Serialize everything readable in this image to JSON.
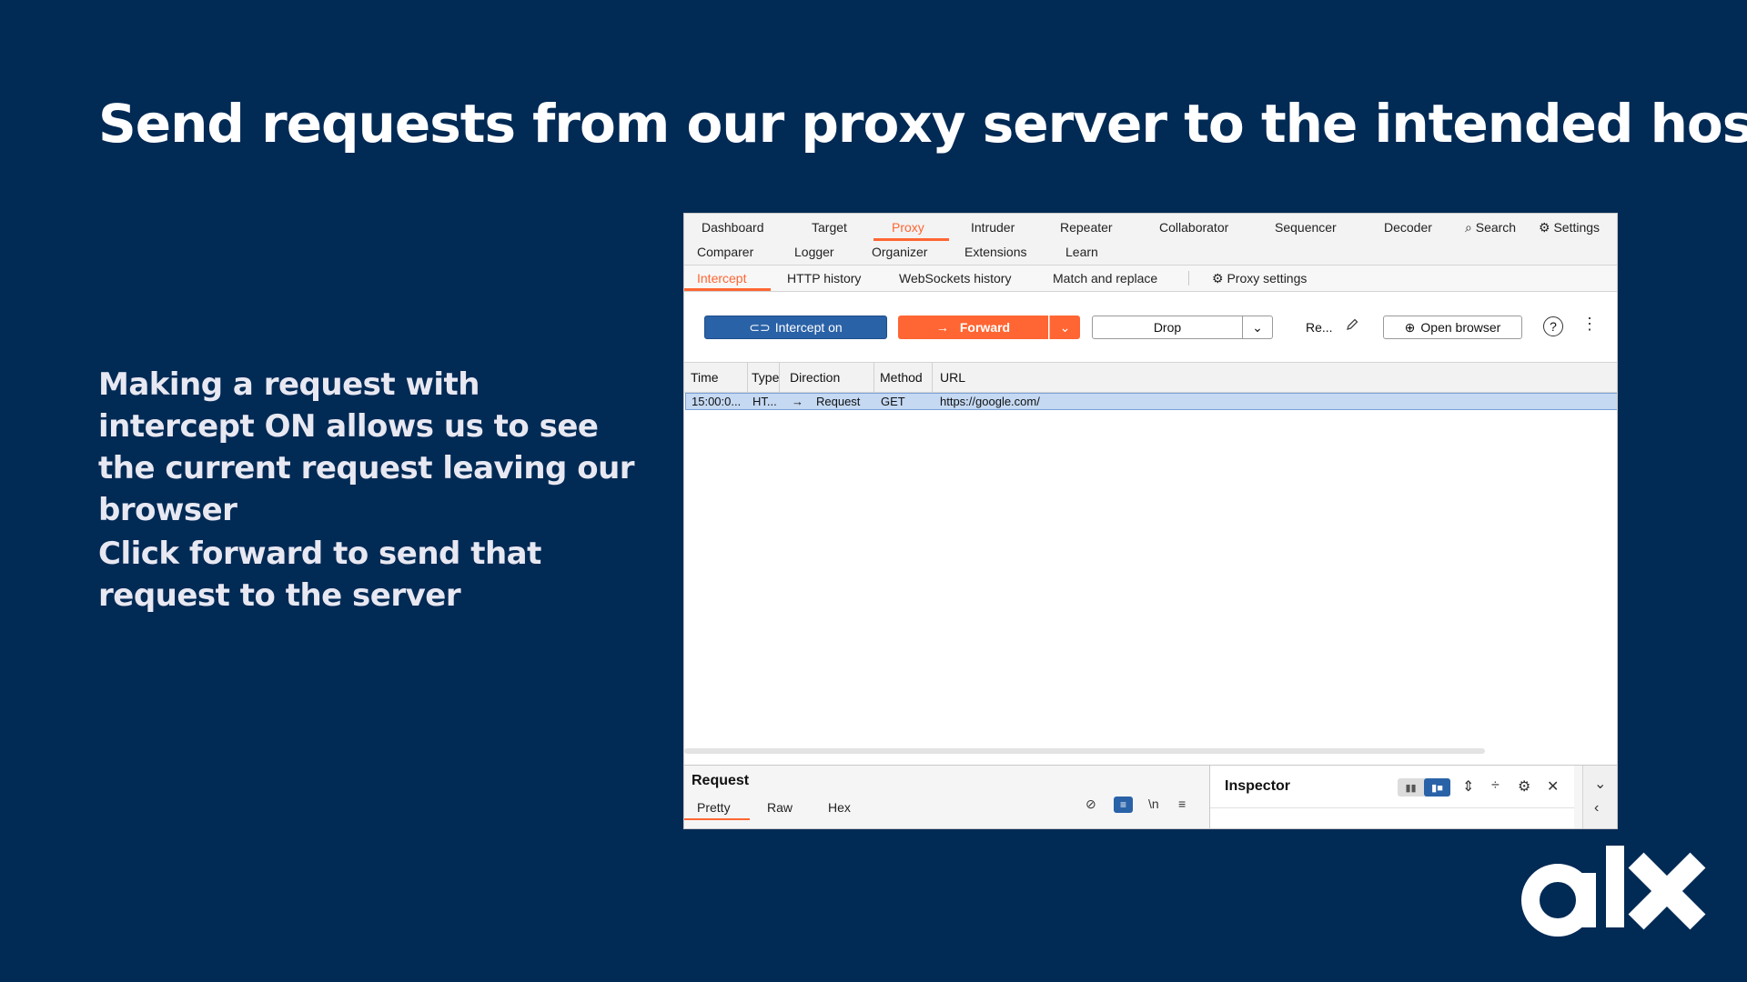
{
  "slide": {
    "title": "Send requests from our proxy server to the intended host.",
    "paragraph1": "Making a request with intercept ON allows us to see the current request leaving our browser",
    "paragraph2": "Click forward to send that request to the server",
    "logo_text": "alx",
    "background": "#012a55"
  },
  "burp": {
    "tabs_row1": [
      "Dashboard",
      "Target",
      "Proxy",
      "Intruder",
      "Repeater",
      "Collaborator",
      "Sequencer",
      "Decoder"
    ],
    "tabs_row2": [
      "Comparer",
      "Logger",
      "Organizer",
      "Extensions",
      "Learn"
    ],
    "active_tab": "Proxy",
    "search_label": "Search",
    "settings_label": "Settings",
    "subtabs": [
      "Intercept",
      "HTTP history",
      "WebSockets history",
      "Match and replace"
    ],
    "proxy_settings_label": "Proxy settings",
    "toolbar": {
      "intercept_label": "Intercept on",
      "forward_label": "Forward",
      "drop_label": "Drop",
      "re_label": "Re...",
      "open_browser_label": "Open browser",
      "help": "?"
    },
    "table": {
      "columns": [
        "Time",
        "Type",
        "Direction",
        "Method",
        "URL"
      ],
      "rows": [
        {
          "time": "15:00:0...",
          "type": "HT...",
          "direction": "Request",
          "method": "GET",
          "url": "https://google.com/"
        }
      ]
    },
    "request_panel": {
      "title": "Request",
      "tabs": [
        "Pretty",
        "Raw",
        "Hex"
      ],
      "newline_icon": "\\n"
    },
    "inspector": {
      "title": "Inspector"
    },
    "accent": "#ff6633",
    "intercept_color": "#2a62a8"
  }
}
